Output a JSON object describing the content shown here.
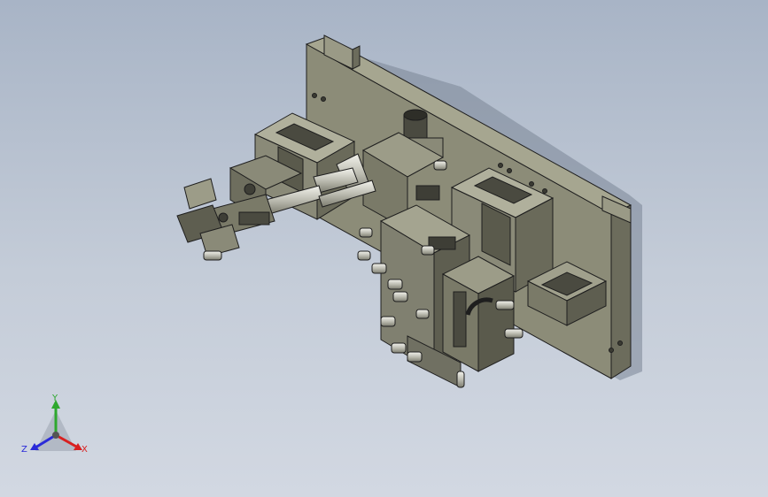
{
  "viewport": {
    "background_top": "#a8b4c6",
    "background_bottom": "#d2d8e2"
  },
  "model": {
    "body_color": "#8c8c78",
    "edge_color": "#1e1e1e",
    "shadow_color": "#6e7886"
  },
  "triad": {
    "y_label": "Y",
    "z_label": "Z",
    "x_label": "X",
    "y_color": "#2ea82e",
    "z_color": "#2a2ad8",
    "x_color": "#d82020"
  }
}
